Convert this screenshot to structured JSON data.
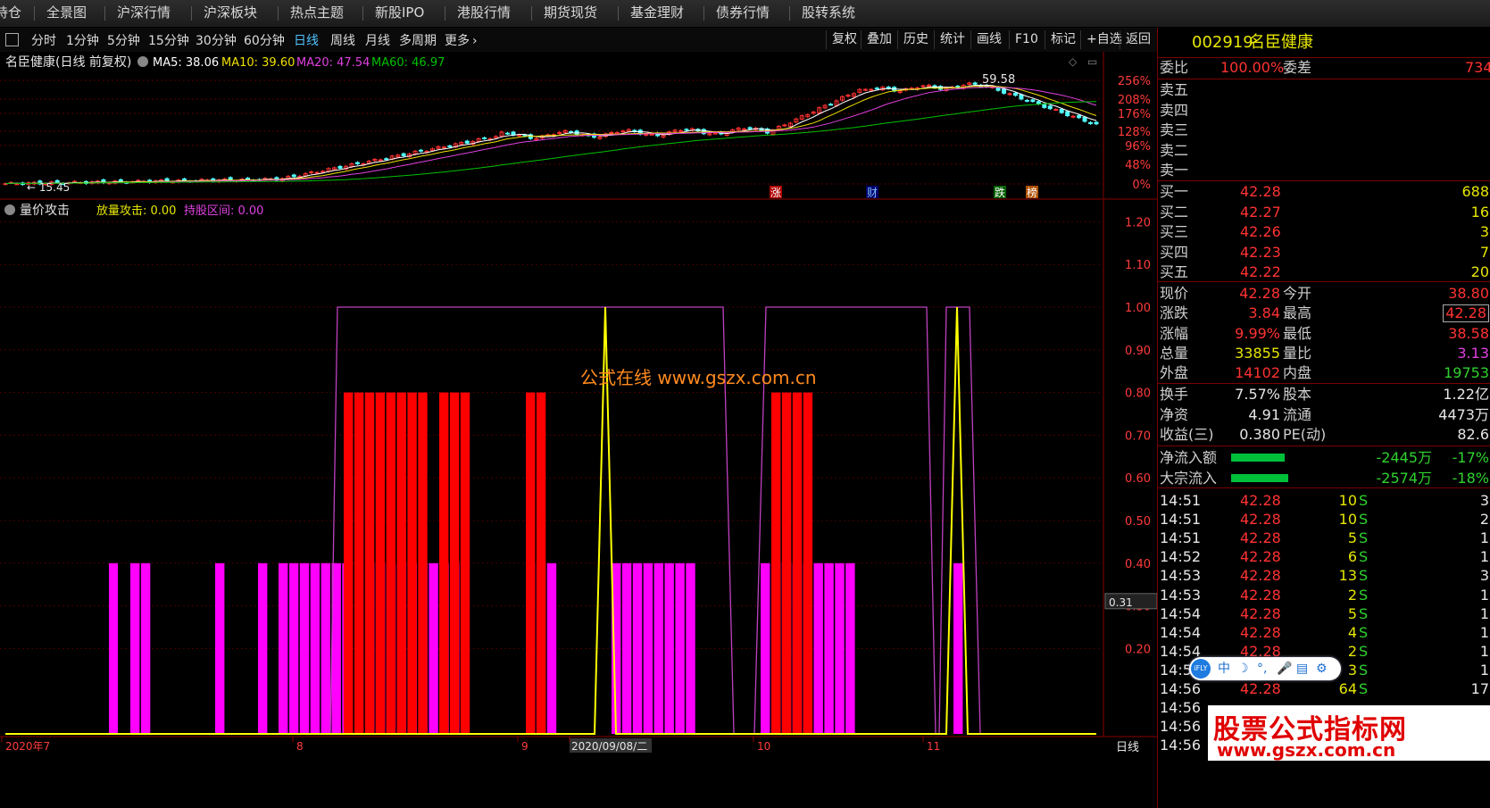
{
  "topnav": [
    "持仓",
    "全景图",
    "沪深行情",
    "沪深板块",
    "热点主题",
    "新股IPO",
    "港股行情",
    "期货现货",
    "基金理财",
    "债券行情",
    "股转系统"
  ],
  "periods": [
    "分时",
    "1分钟",
    "5分钟",
    "15分钟",
    "30分钟",
    "60分钟",
    "日线",
    "周线",
    "月线",
    "多周期",
    "更多"
  ],
  "active_period": "日线",
  "tool_buttons": [
    "复权",
    "叠加",
    "历史",
    "统计",
    "画线",
    "F10",
    "标记",
    "+自选",
    "返回"
  ],
  "stock": {
    "code": "002919",
    "name": "名臣健康"
  },
  "main_chart": {
    "title": "名臣健康(日线 前复权)",
    "ma": [
      {
        "label": "MA5: 38.06",
        "color": "#ffffff"
      },
      {
        "label": "MA10: 39.60",
        "color": "#f0e000"
      },
      {
        "label": "MA20: 47.54",
        "color": "#e040e0"
      },
      {
        "label": "MA60: 46.97",
        "color": "#00c000"
      }
    ],
    "y_ticks": [
      "256%",
      "208%",
      "176%",
      "128%",
      "96%",
      "48%",
      "0%"
    ],
    "high_label": "59.58",
    "low_label": "← 15.45",
    "markers": [
      {
        "text": "涨",
        "bg": "#b00000",
        "color": "#ffffff"
      },
      {
        "text": "财",
        "bg": "#00006a",
        "color": "#7fbfff"
      },
      {
        "text": "跌",
        "bg": "#006000",
        "color": "#ffffff"
      },
      {
        "text": "榜",
        "bg": "#b05000",
        "color": "#ffffff"
      }
    ]
  },
  "indicator": {
    "name": "量价攻击",
    "line1": "放量攻击: 0.00",
    "line2": "持股区间: 0.00",
    "y_ticks": [
      "1.20",
      "1.10",
      "1.00",
      "0.90",
      "0.80",
      "0.70",
      "0.60",
      "0.50",
      "0.40",
      "0.30",
      "0.20"
    ],
    "cursor_value": "0.31",
    "watermark": "公式在线 www.gszx.com.cn"
  },
  "x_axis": {
    "labels": [
      "2020年7",
      "8",
      "9",
      "2020/09/08/二",
      "10",
      "11"
    ],
    "period": "日线"
  },
  "right_panel": {
    "weibi_label": "委比",
    "weibi": "100.00%",
    "weicha_label": "委差",
    "weicha": "734",
    "asks": [
      "卖五",
      "卖四",
      "卖三",
      "卖二",
      "卖一"
    ],
    "bids": [
      {
        "label": "买一",
        "price": "42.28",
        "vol": "688"
      },
      {
        "label": "买二",
        "price": "42.27",
        "vol": "16"
      },
      {
        "label": "买三",
        "price": "42.26",
        "vol": "3"
      },
      {
        "label": "买四",
        "price": "42.23",
        "vol": "7"
      },
      {
        "label": "买五",
        "price": "42.22",
        "vol": "20"
      }
    ],
    "stats": [
      {
        "l1": "现价",
        "v1": "42.28",
        "c1": "red",
        "l2": "今开",
        "v2": "38.80",
        "c2": "red"
      },
      {
        "l1": "涨跌",
        "v1": "3.84",
        "c1": "red",
        "l2": "最高",
        "v2": "42.28",
        "c2": "red"
      },
      {
        "l1": "涨幅",
        "v1": "9.99%",
        "c1": "red",
        "l2": "最低",
        "v2": "38.58",
        "c2": "red"
      },
      {
        "l1": "总量",
        "v1": "33855",
        "c1": "yel",
        "l2": "量比",
        "v2": "3.13",
        "c2": "mag"
      },
      {
        "l1": "外盘",
        "v1": "14102",
        "c1": "red",
        "l2": "内盘",
        "v2": "19753",
        "c2": "grn"
      }
    ],
    "fund": [
      {
        "l1": "换手",
        "v1": "7.57%",
        "l2": "股本",
        "v2": "1.22亿"
      },
      {
        "l1": "净资",
        "v1": "4.91",
        "l2": "流通",
        "v2": "4473万"
      },
      {
        "l1": "收益(三)",
        "v1": "0.380",
        "l2": "PE(动)",
        "v2": "82.6"
      }
    ],
    "flows": [
      {
        "label": "净流入额",
        "value": "-2445万",
        "pct": "-17%"
      },
      {
        "label": "大宗流入",
        "value": "-2574万",
        "pct": "-18%"
      }
    ],
    "ticks": [
      {
        "t": "14:51",
        "p": "42.28",
        "v": "10",
        "s": "S",
        "n": "3"
      },
      {
        "t": "14:51",
        "p": "42.28",
        "v": "10",
        "s": "S",
        "n": "2"
      },
      {
        "t": "14:51",
        "p": "42.28",
        "v": "5",
        "s": "S",
        "n": "1"
      },
      {
        "t": "14:52",
        "p": "42.28",
        "v": "6",
        "s": "S",
        "n": "1"
      },
      {
        "t": "14:53",
        "p": "42.28",
        "v": "13",
        "s": "S",
        "n": "3"
      },
      {
        "t": "14:53",
        "p": "42.28",
        "v": "2",
        "s": "S",
        "n": "1"
      },
      {
        "t": "14:54",
        "p": "42.28",
        "v": "5",
        "s": "S",
        "n": "1"
      },
      {
        "t": "14:54",
        "p": "42.28",
        "v": "4",
        "s": "S",
        "n": "1"
      },
      {
        "t": "14:54",
        "p": "42.28",
        "v": "2",
        "s": "S",
        "n": "1"
      },
      {
        "t": "14:55",
        "p": "42.28",
        "v": "3",
        "s": "S",
        "n": "1"
      },
      {
        "t": "14:56",
        "p": "42.28",
        "v": "64",
        "s": "S",
        "n": "17"
      },
      {
        "t": "14:56",
        "p": "",
        "v": "",
        "s": "",
        "n": ""
      },
      {
        "t": "14:56",
        "p": "",
        "v": "",
        "s": "",
        "n": ""
      },
      {
        "t": "14:56",
        "p": "",
        "v": "",
        "s": "",
        "n": ""
      }
    ]
  },
  "ifly_label": "iFLY",
  "ifly_glyphs": [
    "中",
    "☽",
    "°,",
    "🎤",
    "▤",
    "⚙"
  ],
  "watermark_bottom": {
    "title": "股票公式指标网",
    "url": "www.gszx.com.cn"
  },
  "colors": {
    "up": "#ff3232",
    "down": "#54ffff",
    "attack_bar": "#ff0000",
    "hold_bar": "#ff00ff",
    "yellow_line": "#ffff00",
    "purple_line": "#c040c0"
  }
}
